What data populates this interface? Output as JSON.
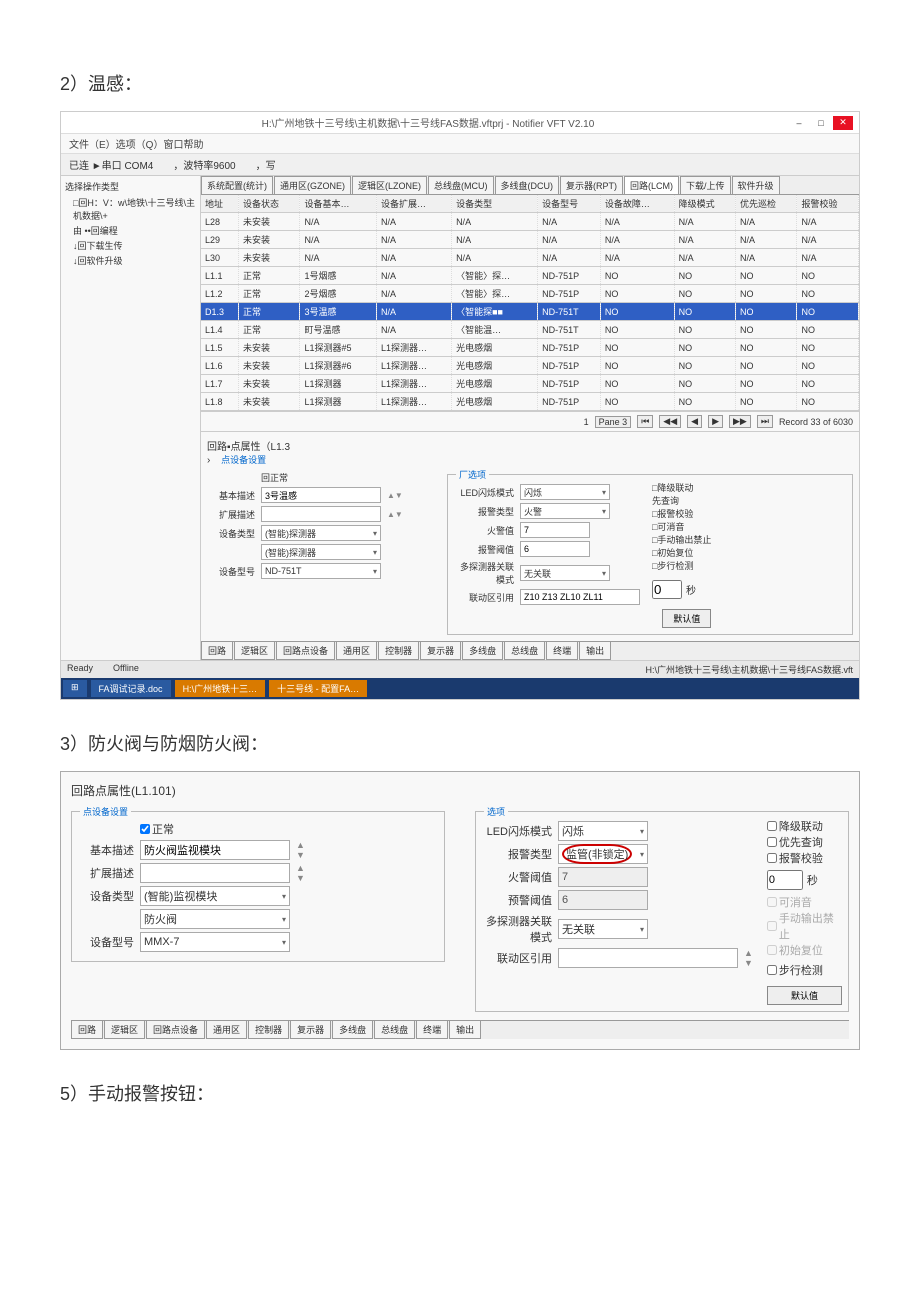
{
  "section1_title": "2）温感：",
  "app": {
    "title": "H:\\广州地铁十三号线\\主机数据\\十三号线FAS数据.vftprj - Notifier VFT V2.10",
    "menu": "文件（E）选项（Q）窗口帮助",
    "toolbar_connect": "已连 ►串口 COM4",
    "toolbar_baud": "，波特率9600",
    "toolbar_write": "，写",
    "left_title": "选择操作类型",
    "tree_root": "□回H：V：w\\地铁\\十三号线\\主机数据\\+",
    "tree_items": [
      "由 ••回编程",
      "↓回下载生传",
      "↓回软件升级"
    ],
    "tabs": [
      "系统配置(统计)",
      "通用区(GZONE)",
      "逻辑区(LZONE)",
      "总线盘(MCU)",
      "多线盘(DCU)",
      "复示器(RPT)",
      "回路(LCM)",
      "下载/上传",
      "软件升级"
    ],
    "columns": [
      "地址",
      "设备状态",
      "设备基本…",
      "设备扩展…",
      "设备类型",
      "设备型号",
      "设备故障…",
      "降级模式",
      "优先巡检",
      "报警校验"
    ],
    "rows": [
      {
        "c": [
          "L28",
          "未安装",
          "N/A",
          "N/A",
          "N/A",
          "N/A",
          "N/A",
          "N/A",
          "N/A",
          "N/A"
        ]
      },
      {
        "c": [
          "L29",
          "未安装",
          "N/A",
          "N/A",
          "N/A",
          "N/A",
          "N/A",
          "N/A",
          "N/A",
          "N/A"
        ]
      },
      {
        "c": [
          "L30",
          "未安装",
          "N/A",
          "N/A",
          "N/A",
          "N/A",
          "N/A",
          "N/A",
          "N/A",
          "N/A"
        ]
      },
      {
        "c": [
          "L1.1",
          "正常",
          "1号烟感",
          "N/A",
          "〈智能〉探…",
          "ND-751P",
          "NO",
          "NO",
          "NO",
          "NO"
        ]
      },
      {
        "c": [
          "L1.2",
          "正常",
          "2号烟感",
          "N/A",
          "〈智能〉探…",
          "ND-751P",
          "NO",
          "NO",
          "NO",
          "NO"
        ]
      },
      {
        "c": [
          "D1.3",
          "正常",
          "3号温感",
          "N/A",
          "〈智能探■■",
          "ND-751T",
          "NO",
          "NO",
          "NO",
          "NO"
        ],
        "sel": true
      },
      {
        "c": [
          "L1.4",
          "正常",
          "町号温感",
          "N/A",
          "〈智能温…",
          "ND-751T",
          "NO",
          "NO",
          "NO",
          "NO"
        ]
      },
      {
        "c": [
          "L1.5",
          "未安装",
          "L1探测器#5",
          "L1探测器…",
          "光电感烟",
          "ND-751P",
          "NO",
          "NO",
          "NO",
          "NO"
        ]
      },
      {
        "c": [
          "L1.6",
          "未安装",
          "L1探测器#6",
          "L1探测器…",
          "光电感烟",
          "ND-751P",
          "NO",
          "NO",
          "NO",
          "NO"
        ]
      },
      {
        "c": [
          "L1.7",
          "未安装",
          "L1探测器",
          "L1探测器…",
          "光电感烟",
          "ND-751P",
          "NO",
          "NO",
          "NO",
          "NO"
        ]
      },
      {
        "c": [
          "L1.8",
          "未安装",
          "L1探测器",
          "L1探测器…",
          "光电感烟",
          "ND-751P",
          "NO",
          "NO",
          "NO",
          "NO"
        ]
      }
    ],
    "pager_page": "1",
    "pager_pane": "Pane 3",
    "pager_record": "Record 33 of 6030",
    "detail_header": "回路▪点属性（L1.3",
    "detail_link": "点设备设置",
    "normal_chk": "回正常",
    "form_labels": {
      "basic": "基本描述",
      "ext": "扩展描述",
      "dtype": "设备类型",
      "dmodel": "设备型号"
    },
    "form_values": {
      "basic": "3号温感",
      "dtype1": "(智能)探测器",
      "dtype2": "(智能)探测器",
      "dmodel": "ND-751T"
    },
    "opt_legend": "厂选项",
    "opt_labels": {
      "led": "LED闪烁模式",
      "alarm": "报警类型",
      "fire": "火警值",
      "prealarm": "报警阈值",
      "multi": "多探测器关联模式",
      "zone": "联动区引用"
    },
    "opt_values": {
      "led": "闪烁",
      "alarm": "火警",
      "fire": "7",
      "prealarm": "6",
      "multi": "无关联",
      "zone": "Z10 Z13 ZL10 ZL11"
    },
    "opt_chks": [
      "□降级联动",
      "先查询",
      "□报警校验",
      "□可消音",
      "□手动输出禁止",
      "□初始复位",
      "□步行检测"
    ],
    "opt_sec": "0",
    "opt_sec_unit": "秒",
    "btn_default": "默认值",
    "bottom_tabs": [
      "回路",
      "逻辑区",
      "回路点设备",
      "通用区",
      "控制器",
      "复示器",
      "多线盘",
      "总线盘",
      "终端",
      "输出"
    ],
    "status_ready": "Ready",
    "status_offline": "Offline",
    "status_path": "H:\\广州地铁十三号线\\主机数据\\十三号线FAS数据.vft",
    "taskbar": [
      "FA调试记录.doc",
      "H:\\广州地铁十三…",
      "十三号线 - 配置FA…"
    ]
  },
  "section2_title": "3）防火阀与防烟防火阀：",
  "panel2": {
    "title": "回路点属性(L1.101)",
    "legend1": "点设备设置",
    "legend2": "选项",
    "normal": "正常",
    "labels": {
      "basic": "基本描述",
      "ext": "扩展描述",
      "dtype": "设备类型",
      "dmodel": "设备型号"
    },
    "values": {
      "basic": "防火阀监视模块",
      "dtype1": "(智能)监视模块",
      "dtype2": "防火阀",
      "dmodel": "MMX-7"
    },
    "opt_labels": {
      "led": "LED闪烁模式",
      "alarm": "报警类型",
      "fire": "火警阈值",
      "prealarm": "预警阈值",
      "multi": "多探测器关联模式",
      "zone": "联动区引用"
    },
    "opt_values": {
      "led": "闪烁",
      "alarm": "监管(非锁定)",
      "fire": "7",
      "prealarm": "6",
      "multi": "无关联",
      "zone": ""
    },
    "chks": [
      "降级联动",
      "优先查询",
      "报警校验"
    ],
    "chks_disabled": [
      "可消音",
      "手动输出禁止",
      "初始复位"
    ],
    "chk_walk": "步行检测",
    "sec": "0",
    "sec_unit": "秒",
    "btn_default": "默认值",
    "bottom_tabs": [
      "回路",
      "逻辑区",
      "回路点设备",
      "通用区",
      "控制器",
      "复示器",
      "多线盘",
      "总线盘",
      "终端",
      "输出"
    ]
  },
  "section3_title": "5）手动报警按钮："
}
